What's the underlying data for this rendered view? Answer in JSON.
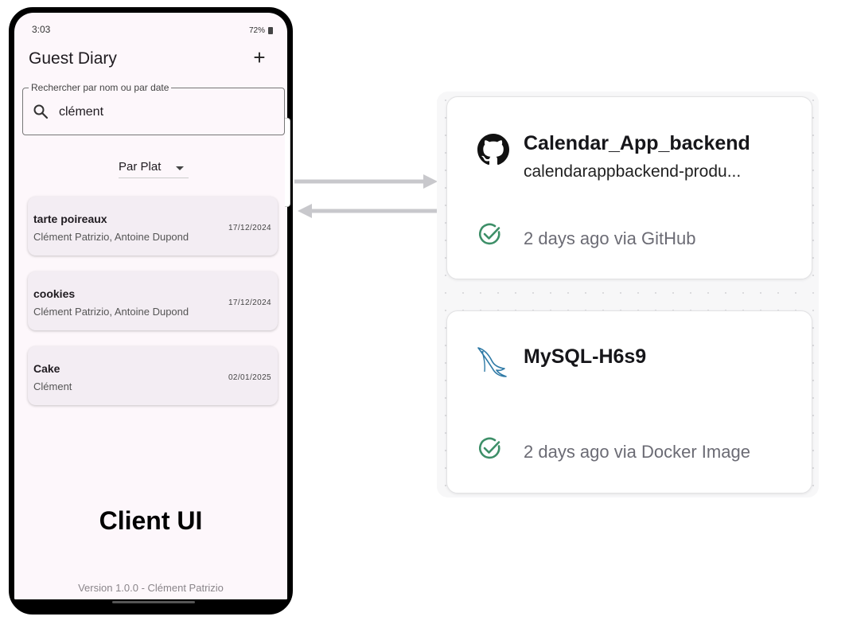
{
  "phone": {
    "status_time": "3:03",
    "status_extra": "[ ] [ ] ✳ •",
    "status_battery": "72%",
    "app_title": "Guest Diary",
    "add_label": "+",
    "search": {
      "label": "Rechercher par nom ou par date",
      "value": "clément"
    },
    "filter": {
      "selected": "Par Plat"
    },
    "entries": [
      {
        "title": "tarte poireaux",
        "guests": "Clément Patrizio, Antoine Dupond",
        "date": "17/12/2024"
      },
      {
        "title": "cookies",
        "guests": "Clément Patrizio, Antoine Dupond",
        "date": "17/12/2024"
      },
      {
        "title": "Cake",
        "guests": "Clément",
        "date": "02/01/2025"
      }
    ],
    "caption": "Client UI",
    "footer": "Version 1.0.0  -  Clément Patrizio"
  },
  "services": [
    {
      "icon": "github-icon",
      "name": "Calendar_App_backend",
      "url": "calendarappbackend-produ...",
      "status": "2 days ago via GitHub"
    },
    {
      "icon": "mysql-dolphin-icon",
      "name": "MySQL-H6s9",
      "url": "",
      "status": "2 days ago via Docker Image"
    }
  ],
  "colors": {
    "check": "#3d8f68",
    "arrow": "#c8c8cc",
    "phone_bg": "#fdf7fb",
    "card_bg": "#f3edf3"
  }
}
